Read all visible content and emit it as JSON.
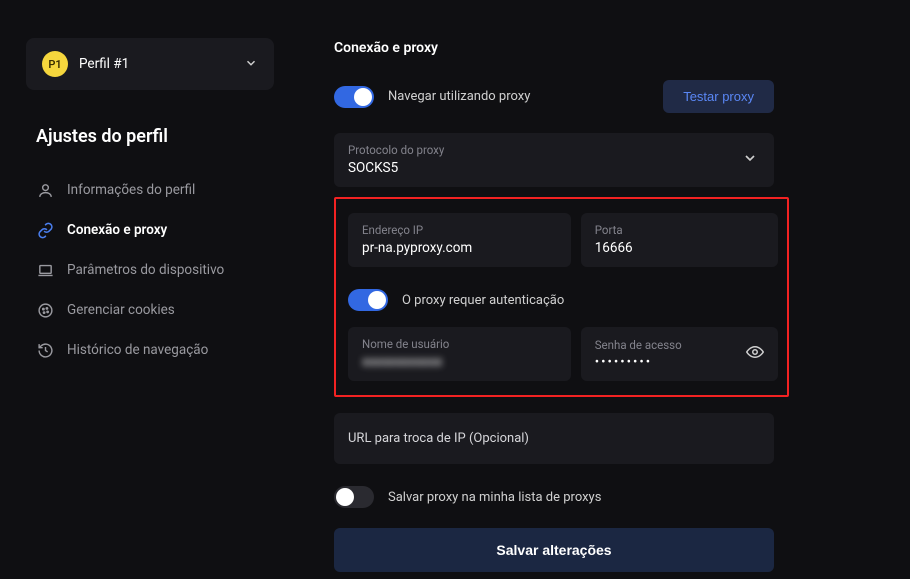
{
  "sidebar": {
    "profile_badge": "P1",
    "profile_name": "Perfil #1",
    "section_title": "Ajustes do perfil",
    "items": [
      {
        "label": "Informações do perfil"
      },
      {
        "label": "Conexão e proxy"
      },
      {
        "label": "Parâmetros do dispositivo"
      },
      {
        "label": "Gerenciar cookies"
      },
      {
        "label": "Histórico de navegação"
      }
    ]
  },
  "main": {
    "title": "Conexão e proxy",
    "toggle_browse_label": "Navegar utilizando proxy",
    "test_button": "Testar proxy",
    "protocol_label": "Protocolo do proxy",
    "protocol_value": "SOCKS5",
    "ip_label": "Endereço IP",
    "ip_value": "pr-na.pyproxy.com",
    "port_label": "Porta",
    "port_value": "16666",
    "auth_toggle_label": "O proxy requer autenticação",
    "username_label": "Nome de usuário",
    "username_value": "xxxxxxxxxxxx",
    "password_label": "Senha de acesso",
    "password_value": "•••••••••",
    "url_placeholder": "URL para troca de IP (Opcional)",
    "save_list_label": "Salvar proxy na minha lista de proxys",
    "save_button": "Salvar alterações"
  }
}
